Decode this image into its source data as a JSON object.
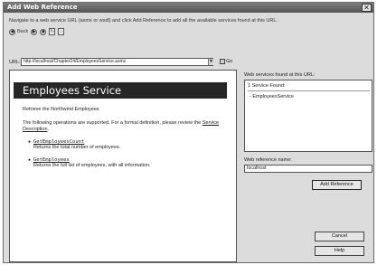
{
  "dialog": {
    "title": "Add Web Reference",
    "close_glyph": "✕",
    "instruction": "Navigate to a web service URL (asmx or wsdl) and click Add Reference to add all the available services found at this URL."
  },
  "nav": {
    "back_label": "Back",
    "back_icon": "arrow-left-icon",
    "forward_icon": "arrow-right-icon",
    "stop_icon": "stop-icon",
    "refresh_icon": "refresh-icon",
    "home_icon": "home-icon"
  },
  "url": {
    "label": "URL:",
    "value": "http://localhost/Chapter24/EmployeesService.asmx",
    "go_label": "Go"
  },
  "browser": {
    "service_title": "Employees Service",
    "service_description": "Retrieve the Northwind Employees",
    "ops_text_prefix": "The following operations are supported. For a formal definition, please review the ",
    "ops_link": "Service Description",
    "ops_text_suffix": ".",
    "operations": [
      {
        "name": "GetEmployeesCount",
        "description": "Returns the total number of employees."
      },
      {
        "name": "GetEmployees",
        "description": "Returns the full list of employees, with all information."
      }
    ]
  },
  "services": {
    "label": "Web services found at this URL:",
    "count": "1 Service Found:",
    "items": [
      "- EmployeesService"
    ]
  },
  "reference": {
    "label": "Web reference name:",
    "value": "localhost"
  },
  "buttons": {
    "add_reference": "Add Reference",
    "cancel": "Cancel",
    "help": "Help"
  }
}
